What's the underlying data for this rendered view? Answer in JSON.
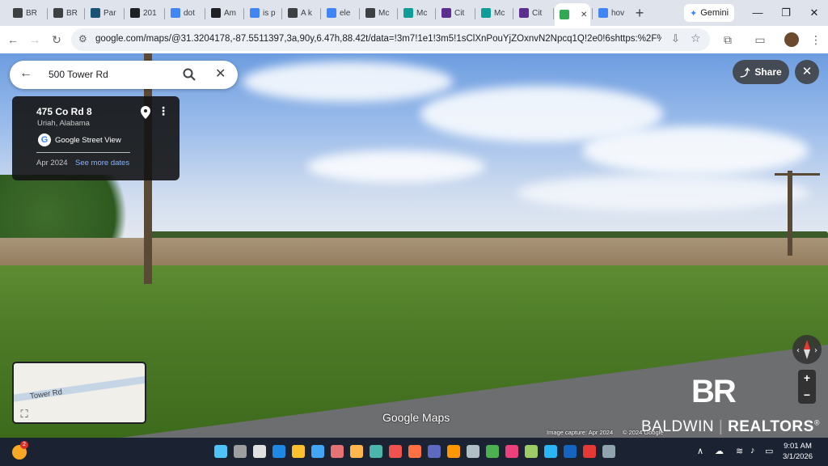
{
  "tabs": [
    {
      "label": "BR",
      "icon": "br-icon",
      "color": "#3c4043"
    },
    {
      "label": "BR",
      "icon": "br-icon",
      "color": "#3c4043"
    },
    {
      "label": "Par",
      "icon": "chart-icon",
      "color": "#1a5276"
    },
    {
      "label": "201",
      "icon": "circle-icon",
      "color": "#202124"
    },
    {
      "label": "dot",
      "icon": "smile-icon",
      "color": "#4285f4"
    },
    {
      "label": "Am",
      "icon": "amazon-icon",
      "color": "#202124"
    },
    {
      "label": "is p",
      "icon": "google-icon",
      "color": "#4285f4"
    },
    {
      "label": "A k",
      "icon": "globe-icon",
      "color": "#3c4043"
    },
    {
      "label": "ele",
      "icon": "google-icon",
      "color": "#4285f4"
    },
    {
      "label": "Mc",
      "icon": "globe-icon",
      "color": "#3c4043"
    },
    {
      "label": "Mc",
      "icon": "tile-icon",
      "color": "#0f9d9a"
    },
    {
      "label": "Cit",
      "icon": "slash-icon",
      "color": "#5b2d8e"
    },
    {
      "label": "Mc",
      "icon": "tile-icon",
      "color": "#0f9d9a"
    },
    {
      "label": "Cit",
      "icon": "slash-icon",
      "color": "#5b2d8e"
    },
    {
      "label": "",
      "icon": "maps-icon",
      "color": "#34a853",
      "active": true
    },
    {
      "label": "hov",
      "icon": "google-icon",
      "color": "#4285f4"
    }
  ],
  "gemini_label": "Gemini",
  "address_bar": {
    "url": "google.com/maps/@31.3204178,-87.5511397,3a,90y,6.47h,88.42t/data=!3m7!1e1!3m5!1sClXnPouYjZOxnvN2Npcq1Q!2e0!6shttps:%2F%2Fstreetviewpi..."
  },
  "search": {
    "query": "500 Tower Rd"
  },
  "info_card": {
    "address": "475 Co Rd 8",
    "city": "Uriah, Alabama",
    "source": "Google Street View",
    "date": "Apr 2024",
    "more_dates": "See more dates"
  },
  "share_label": "Share",
  "zoom": {
    "in": "+",
    "out": "−"
  },
  "minimap": {
    "road_label": "Tower Rd"
  },
  "watermark": "Google Maps",
  "image_capture": "Image capture: Apr 2024",
  "copyright": "© 2024 Google",
  "brand": {
    "logo": "BR",
    "name_part1": "BALDWIN",
    "name_part2": "REALTORS",
    "reg": "®"
  },
  "taskbar": {
    "notification_count": "2",
    "time": "9:01 AM",
    "date": "3/1/2026"
  }
}
